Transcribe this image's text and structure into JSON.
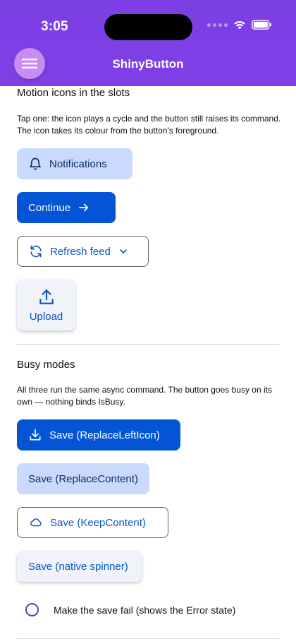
{
  "status": {
    "time": "3:05"
  },
  "nav": {
    "title": "ShinyButton"
  },
  "motion": {
    "title": "Motion icons in the slots",
    "description": "Tap one: the icon plays a cycle and the button still raises its command. The icon takes its colour from the button's foreground.",
    "notifications_label": "Notifications",
    "continue_label": "Continue",
    "refresh_label": "Refresh feed",
    "upload_label": "Upload"
  },
  "busy": {
    "title": "Busy modes",
    "description": "All three run the same async command. The button goes busy on its own — nothing binds IsBusy.",
    "replace_left_label": "Save (ReplaceLeftIcon)",
    "replace_content_label": "Save (ReplaceContent)",
    "keep_content_label": "Save (KeepContent)",
    "native_spinner_label": "Save (native spinner)",
    "fail_toggle_label": "Make the save fail (shows the Error state)"
  },
  "colors": {
    "header": "#7c3fe4",
    "accent": "#0355d6",
    "tonal": "#c9dafc",
    "menu_button": "#c98cf3"
  }
}
